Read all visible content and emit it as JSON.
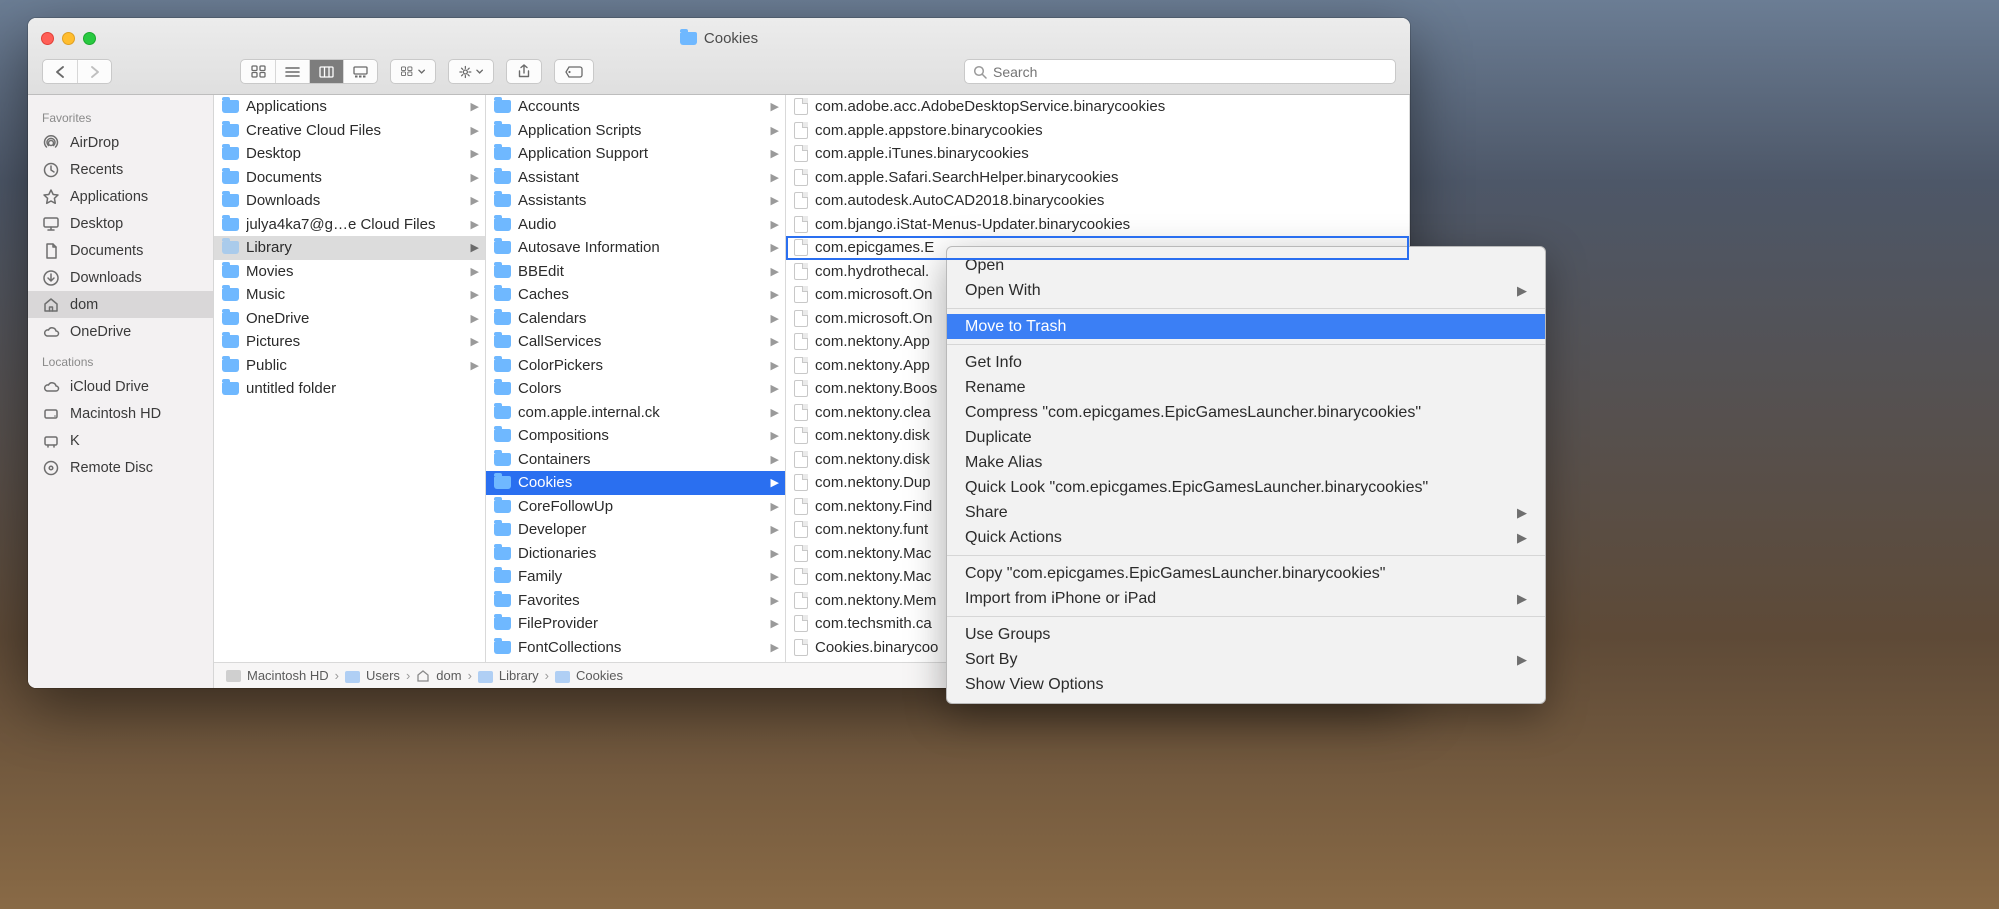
{
  "window": {
    "title": "Cookies",
    "search_placeholder": "Search"
  },
  "sidebar": {
    "favorites_header": "Favorites",
    "locations_header": "Locations",
    "favorites": [
      {
        "icon": "airdrop",
        "label": "AirDrop"
      },
      {
        "icon": "recents",
        "label": "Recents"
      },
      {
        "icon": "apps",
        "label": "Applications"
      },
      {
        "icon": "desktop",
        "label": "Desktop"
      },
      {
        "icon": "documents",
        "label": "Documents"
      },
      {
        "icon": "downloads",
        "label": "Downloads"
      },
      {
        "icon": "home",
        "label": "dom",
        "selected": true
      },
      {
        "icon": "onedrive",
        "label": "OneDrive"
      }
    ],
    "locations": [
      {
        "icon": "icloud",
        "label": "iCloud Drive"
      },
      {
        "icon": "hdd",
        "label": "Macintosh HD"
      },
      {
        "icon": "ext",
        "label": "K"
      },
      {
        "icon": "disc",
        "label": "Remote Disc"
      }
    ]
  },
  "col1": [
    {
      "label": "Applications",
      "type": "folder",
      "arrow": true
    },
    {
      "label": "Creative Cloud Files",
      "type": "folder",
      "arrow": true
    },
    {
      "label": "Desktop",
      "type": "folder",
      "arrow": true
    },
    {
      "label": "Documents",
      "type": "folder",
      "arrow": true
    },
    {
      "label": "Downloads",
      "type": "folder",
      "arrow": true
    },
    {
      "label": "julya4ka7@g…e Cloud Files",
      "type": "folder",
      "arrow": true
    },
    {
      "label": "Library",
      "type": "folder",
      "arrow": true,
      "selected": "grey",
      "dim": true
    },
    {
      "label": "Movies",
      "type": "folder",
      "arrow": true
    },
    {
      "label": "Music",
      "type": "folder",
      "arrow": true
    },
    {
      "label": "OneDrive",
      "type": "folder",
      "arrow": true
    },
    {
      "label": "Pictures",
      "type": "folder",
      "arrow": true
    },
    {
      "label": "Public",
      "type": "folder",
      "arrow": true
    },
    {
      "label": "untitled folder",
      "type": "folder",
      "arrow": false
    }
  ],
  "col2": [
    {
      "label": "Accounts",
      "arrow": true
    },
    {
      "label": "Application Scripts",
      "arrow": true
    },
    {
      "label": "Application Support",
      "arrow": true
    },
    {
      "label": "Assistant",
      "arrow": true
    },
    {
      "label": "Assistants",
      "arrow": true
    },
    {
      "label": "Audio",
      "arrow": true
    },
    {
      "label": "Autosave Information",
      "arrow": true
    },
    {
      "label": "BBEdit",
      "arrow": true
    },
    {
      "label": "Caches",
      "arrow": true
    },
    {
      "label": "Calendars",
      "arrow": true
    },
    {
      "label": "CallServices",
      "arrow": true
    },
    {
      "label": "ColorPickers",
      "arrow": true
    },
    {
      "label": "Colors",
      "arrow": true
    },
    {
      "label": "com.apple.internal.ck",
      "arrow": true
    },
    {
      "label": "Compositions",
      "arrow": true
    },
    {
      "label": "Containers",
      "arrow": true
    },
    {
      "label": "Cookies",
      "arrow": true,
      "selected": "blue"
    },
    {
      "label": "CoreFollowUp",
      "arrow": true
    },
    {
      "label": "Developer",
      "arrow": true
    },
    {
      "label": "Dictionaries",
      "arrow": true
    },
    {
      "label": "Family",
      "arrow": true
    },
    {
      "label": "Favorites",
      "arrow": true
    },
    {
      "label": "FileProvider",
      "arrow": true
    },
    {
      "label": "FontCollections",
      "arrow": true
    }
  ],
  "col3": [
    {
      "label": "com.adobe.acc.AdobeDesktopService.binarycookies"
    },
    {
      "label": "com.apple.appstore.binarycookies"
    },
    {
      "label": "com.apple.iTunes.binarycookies"
    },
    {
      "label": "com.apple.Safari.SearchHelper.binarycookies"
    },
    {
      "label": "com.autodesk.AutoCAD2018.binarycookies"
    },
    {
      "label": "com.bjango.iStat-Menus-Updater.binarycookies"
    },
    {
      "label": "com.epicgames.E",
      "selected": "outline"
    },
    {
      "label": "com.hydrothecal."
    },
    {
      "label": "com.microsoft.On"
    },
    {
      "label": "com.microsoft.On"
    },
    {
      "label": "com.nektony.App"
    },
    {
      "label": "com.nektony.App"
    },
    {
      "label": "com.nektony.Boos"
    },
    {
      "label": "com.nektony.clea"
    },
    {
      "label": "com.nektony.disk"
    },
    {
      "label": "com.nektony.disk"
    },
    {
      "label": "com.nektony.Dup"
    },
    {
      "label": "com.nektony.Find"
    },
    {
      "label": "com.nektony.funt"
    },
    {
      "label": "com.nektony.Mac"
    },
    {
      "label": "com.nektony.Mac"
    },
    {
      "label": "com.nektony.Mem"
    },
    {
      "label": "com.techsmith.ca"
    },
    {
      "label": "Cookies.binarycoo"
    }
  ],
  "pathbar": [
    "Macintosh HD",
    "Users",
    "dom",
    "Library",
    "Cookies"
  ],
  "context_menu": {
    "groups": [
      [
        {
          "label": "Open"
        },
        {
          "label": "Open With",
          "submenu": true
        }
      ],
      [
        {
          "label": "Move to Trash",
          "highlight": true
        }
      ],
      [
        {
          "label": "Get Info"
        },
        {
          "label": "Rename"
        },
        {
          "label": "Compress \"com.epicgames.EpicGamesLauncher.binarycookies\""
        },
        {
          "label": "Duplicate"
        },
        {
          "label": "Make Alias"
        },
        {
          "label": "Quick Look \"com.epicgames.EpicGamesLauncher.binarycookies\""
        },
        {
          "label": "Share",
          "submenu": true
        },
        {
          "label": "Quick Actions",
          "submenu": true
        }
      ],
      [
        {
          "label": "Copy \"com.epicgames.EpicGamesLauncher.binarycookies\""
        },
        {
          "label": "Import from iPhone or iPad",
          "submenu": true
        }
      ],
      [
        {
          "label": "Use Groups"
        },
        {
          "label": "Sort By",
          "submenu": true
        },
        {
          "label": "Show View Options"
        }
      ]
    ]
  }
}
